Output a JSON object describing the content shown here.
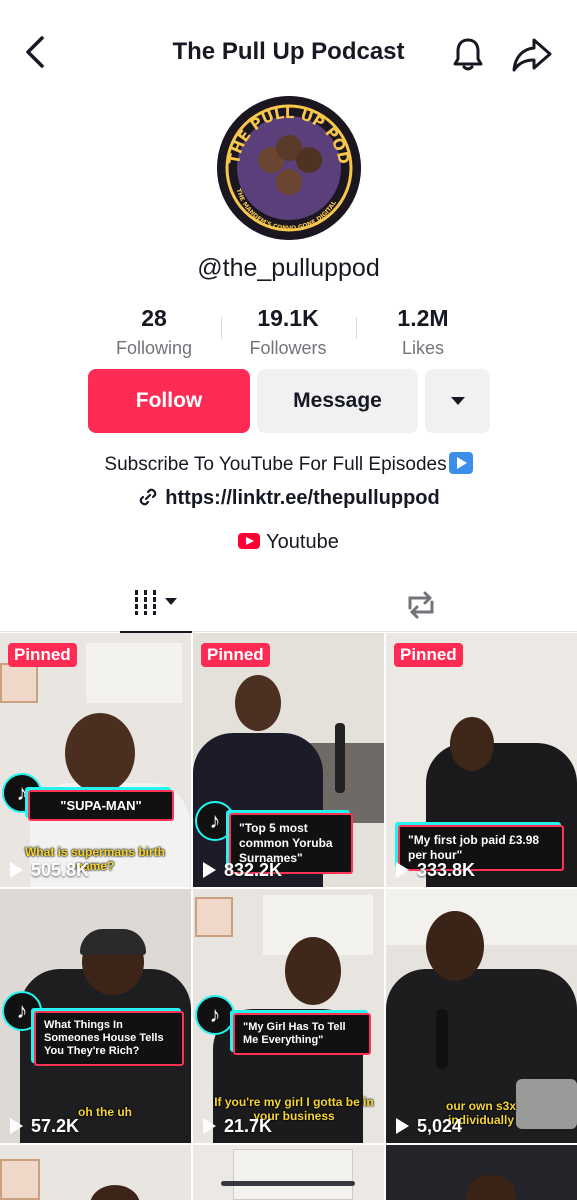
{
  "header": {
    "title": "The Pull Up Podcast"
  },
  "profile": {
    "username": "@the_pulluppod",
    "avatar_text": "THE PULL UP PODCAST",
    "avatar_subtext": "THE MANDEM'S CONVO GONE DIGITAL"
  },
  "stats": [
    {
      "value": "28",
      "label": "Following"
    },
    {
      "value": "19.1K",
      "label": "Followers"
    },
    {
      "value": "1.2M",
      "label": "Likes"
    }
  ],
  "actions": {
    "follow": "Follow",
    "message": "Message"
  },
  "bio": {
    "text": "Subscribe To YouTube For Full Episodes",
    "link": "https://linktr.ee/thepulluppod",
    "youtube": "Youtube"
  },
  "colors": {
    "accent": "#fe2c55",
    "text": "#161823",
    "muted": "#73747a",
    "button_bg": "#f1f1f2"
  },
  "videos": [
    {
      "pinned": "Pinned",
      "views": "505.8K",
      "caption": "\"SUPA-MAN\"",
      "subtitle": "What is supermans birth name?"
    },
    {
      "pinned": "Pinned",
      "views": "832.2K",
      "caption": "\"Top 5 most common Yoruba Surnames\"",
      "subtitle": ""
    },
    {
      "pinned": "Pinned",
      "views": "333.8K",
      "caption": "\"My first job paid £3.98 per hour\"",
      "subtitle": ""
    },
    {
      "pinned": "",
      "views": "57.2K",
      "caption": "What Things In Someones House Tells You They're Rich?",
      "subtitle": "oh the uh"
    },
    {
      "pinned": "",
      "views": "21.7K",
      "caption": "\"My Girl Has To Tell Me Everything\"",
      "subtitle": "If you're my girl I gotta be in your business"
    },
    {
      "pinned": "",
      "views": "5,024",
      "caption": "",
      "subtitle": "our own s3x individually"
    }
  ]
}
